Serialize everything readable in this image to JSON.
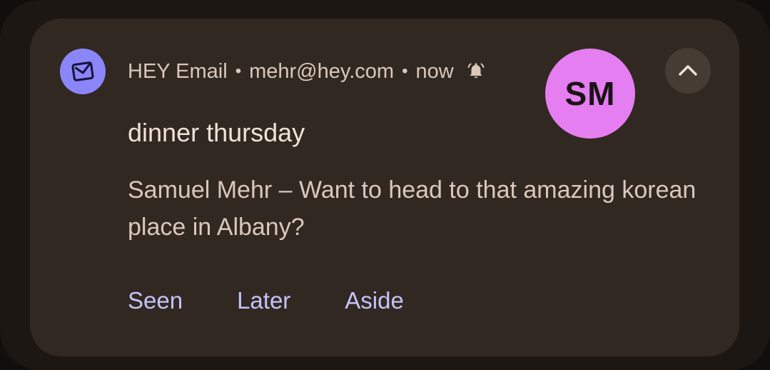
{
  "notification": {
    "app_name": "HEY Email",
    "separator": "•",
    "account": "mehr@hey.com",
    "time": "now",
    "icons": {
      "app": "envelope-icon",
      "alert": "bell-icon",
      "expand": "chevron-up-icon"
    },
    "avatar_initials": "SM",
    "title": "dinner thursday",
    "body": "Samuel Mehr – Want to head to that amazing korean place in Albany?",
    "actions": [
      "Seen",
      "Later",
      "Aside"
    ],
    "colors": {
      "app_icon_bg": "#8a86f7",
      "avatar_bg": "#e57ef0",
      "action_text": "#c4c3fb",
      "card_bg": "#312821"
    }
  }
}
